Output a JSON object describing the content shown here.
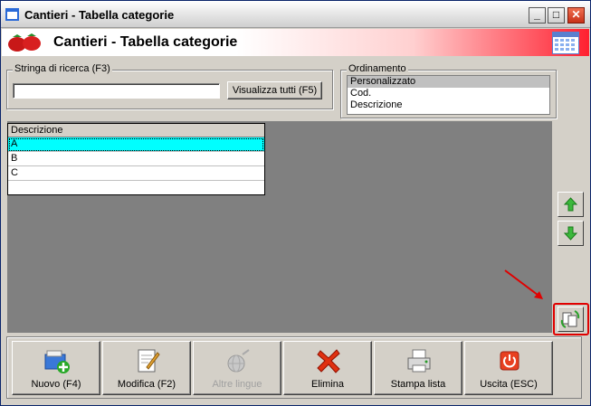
{
  "window": {
    "title": "Cantieri - Tabella categorie"
  },
  "header": {
    "title": "Cantieri - Tabella categorie"
  },
  "search": {
    "group_label": "Stringa di ricerca (F3)",
    "value": "",
    "show_all_label": "Visualizza tutti (F5)"
  },
  "ordering": {
    "group_label": "Ordinamento",
    "options": [
      "Personalizzato",
      "Cod.",
      "Descrizione"
    ],
    "selected": "Personalizzato"
  },
  "grid": {
    "column": "Descrizione",
    "rows": [
      "A",
      "B",
      "C"
    ]
  },
  "toolbar": {
    "new_label": "Nuovo (F4)",
    "edit_label": "Modifica (F2)",
    "languages_label": "Altre lingue",
    "delete_label": "Elimina",
    "print_label": "Stampa lista",
    "exit_label": "Uscita (ESC)"
  },
  "colors": {
    "selected_row": "#00ffff",
    "highlight": "#e00000",
    "grid_background": "#808080"
  }
}
